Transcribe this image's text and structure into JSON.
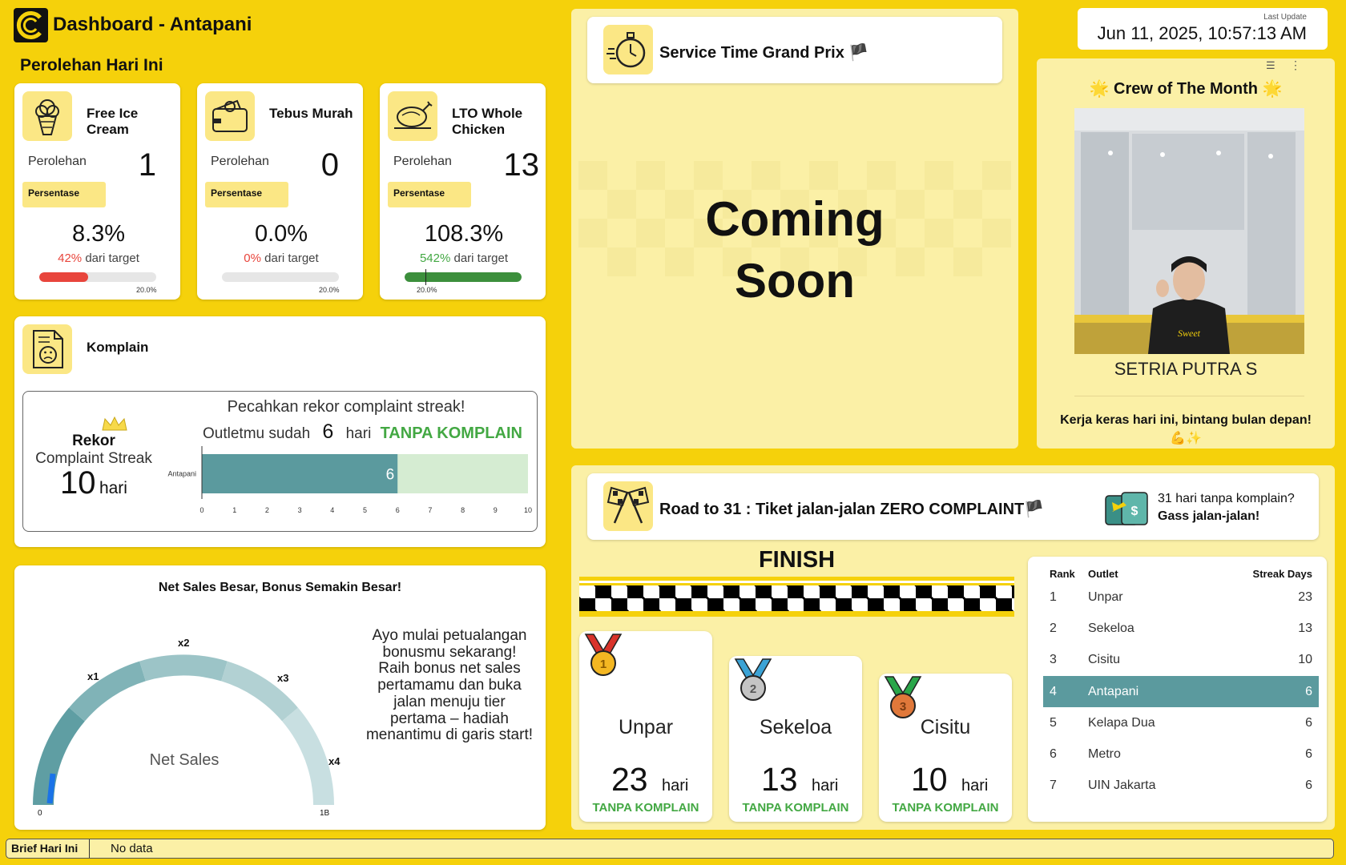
{
  "header": {
    "title": "Dashboard - Antapani",
    "last_update_label": "Last Update",
    "last_update_value": "Jun 11, 2025, 10:57:13 AM"
  },
  "section_title": "Perolehan Hari Ini",
  "kpis": [
    {
      "title": "Free Ice Cream",
      "perolehan_label": "Perolehan",
      "perolehan": "1",
      "persentase_label": "Persentase",
      "percent": "8.3%",
      "target_pct": "42%",
      "target_suffix": "dari target",
      "target_status": "below",
      "progress": 0.42,
      "marker_label": "20.0%"
    },
    {
      "title": "Tebus Murah",
      "perolehan_label": "Perolehan",
      "perolehan": "0",
      "persentase_label": "Persentase",
      "percent": "0.0%",
      "target_pct": "0%",
      "target_suffix": "dari target",
      "target_status": "below",
      "progress": 0.0,
      "marker_label": "20.0%"
    },
    {
      "title": "LTO Whole Chicken",
      "perolehan_label": "Perolehan",
      "perolehan": "13",
      "persentase_label": "Persentase",
      "percent": "108.3%",
      "target_pct": "542%",
      "target_suffix": "dari target",
      "target_status": "above",
      "progress": 1.0,
      "marker_label": "20.0%"
    }
  ],
  "komplain": {
    "title": "Komplain",
    "rekor_label": "Rekor",
    "streak_label": "Complaint Streak",
    "rekor_value": "10",
    "hari": "hari",
    "headline": "Pecahkan rekor complaint streak!",
    "sub_prefix": "Outletmu sudah",
    "current": "6",
    "sub_hari": "hari",
    "sub_highlight": "TANPA KOMPLAIN"
  },
  "chart_data": {
    "type": "bar",
    "orientation": "horizontal",
    "categories": [
      "Antapani"
    ],
    "values": [
      6
    ],
    "target": 10,
    "xlim": [
      0,
      10
    ],
    "xticks": [
      "0",
      "1",
      "2",
      "3",
      "4",
      "5",
      "6",
      "7",
      "8",
      "9",
      "10"
    ],
    "colors": {
      "value": "#5b9a9e",
      "remaining": "#d5ecd2"
    }
  },
  "netsales": {
    "title": "Net Sales Besar, Bonus Semakin Besar!",
    "gauge_label": "Net Sales",
    "tiers": [
      "x1",
      "x2",
      "x3",
      "x4"
    ],
    "min_label": "0",
    "max_label": "1B",
    "message": "Ayo mulai petualangan bonusmu sekarang! Raih bonus net sales pertamamu dan buka jalan menuju tier pertama – hadiah menantimu di garis start!"
  },
  "service_time": {
    "title": "Service Time Grand Prix 🏴",
    "body": [
      "Coming",
      "Soon"
    ]
  },
  "crew": {
    "title": "🌟 Crew of The Month 🌟",
    "name": "SETRIA PUTRA S",
    "message": "Kerja keras hari ini, bintang bulan depan!",
    "emoji": "💪✨"
  },
  "road": {
    "title_bold": "Road to 31",
    "title_rest": " : Tiket jalan-jalan ZERO COMPLAINT🏴",
    "promo_line1": "31 hari tanpa komplain?",
    "promo_line2": "Gass jalan-jalan!",
    "finish": "FINISH",
    "podium": [
      {
        "medal": "1",
        "name": "Unpar",
        "days": "23",
        "unit": "hari",
        "label": "TANPA KOMPLAIN"
      },
      {
        "medal": "2",
        "name": "Sekeloa",
        "days": "13",
        "unit": "hari",
        "label": "TANPA KOMPLAIN"
      },
      {
        "medal": "3",
        "name": "Cisitu",
        "days": "10",
        "unit": "hari",
        "label": "TANPA KOMPLAIN"
      }
    ]
  },
  "ranking": {
    "headers": [
      "Rank",
      "Outlet",
      "Streak Days"
    ],
    "rows": [
      [
        "1",
        "Unpar",
        "23"
      ],
      [
        "2",
        "Sekeloa",
        "13"
      ],
      [
        "3",
        "Cisitu",
        "10"
      ],
      [
        "4",
        "Antapani",
        "6"
      ],
      [
        "5",
        "Kelapa Dua",
        "6"
      ],
      [
        "6",
        "Metro",
        "6"
      ],
      [
        "7",
        "UIN Jakarta",
        "6"
      ]
    ],
    "highlight": "Antapani"
  },
  "brief": {
    "label": "Brief Hari Ini",
    "value": "No data"
  },
  "colors": {
    "background": "#f5d10b",
    "teal": "#5b9a9e",
    "green": "#43a843",
    "red": "#e8453c",
    "pale": "#fbf0a6"
  }
}
